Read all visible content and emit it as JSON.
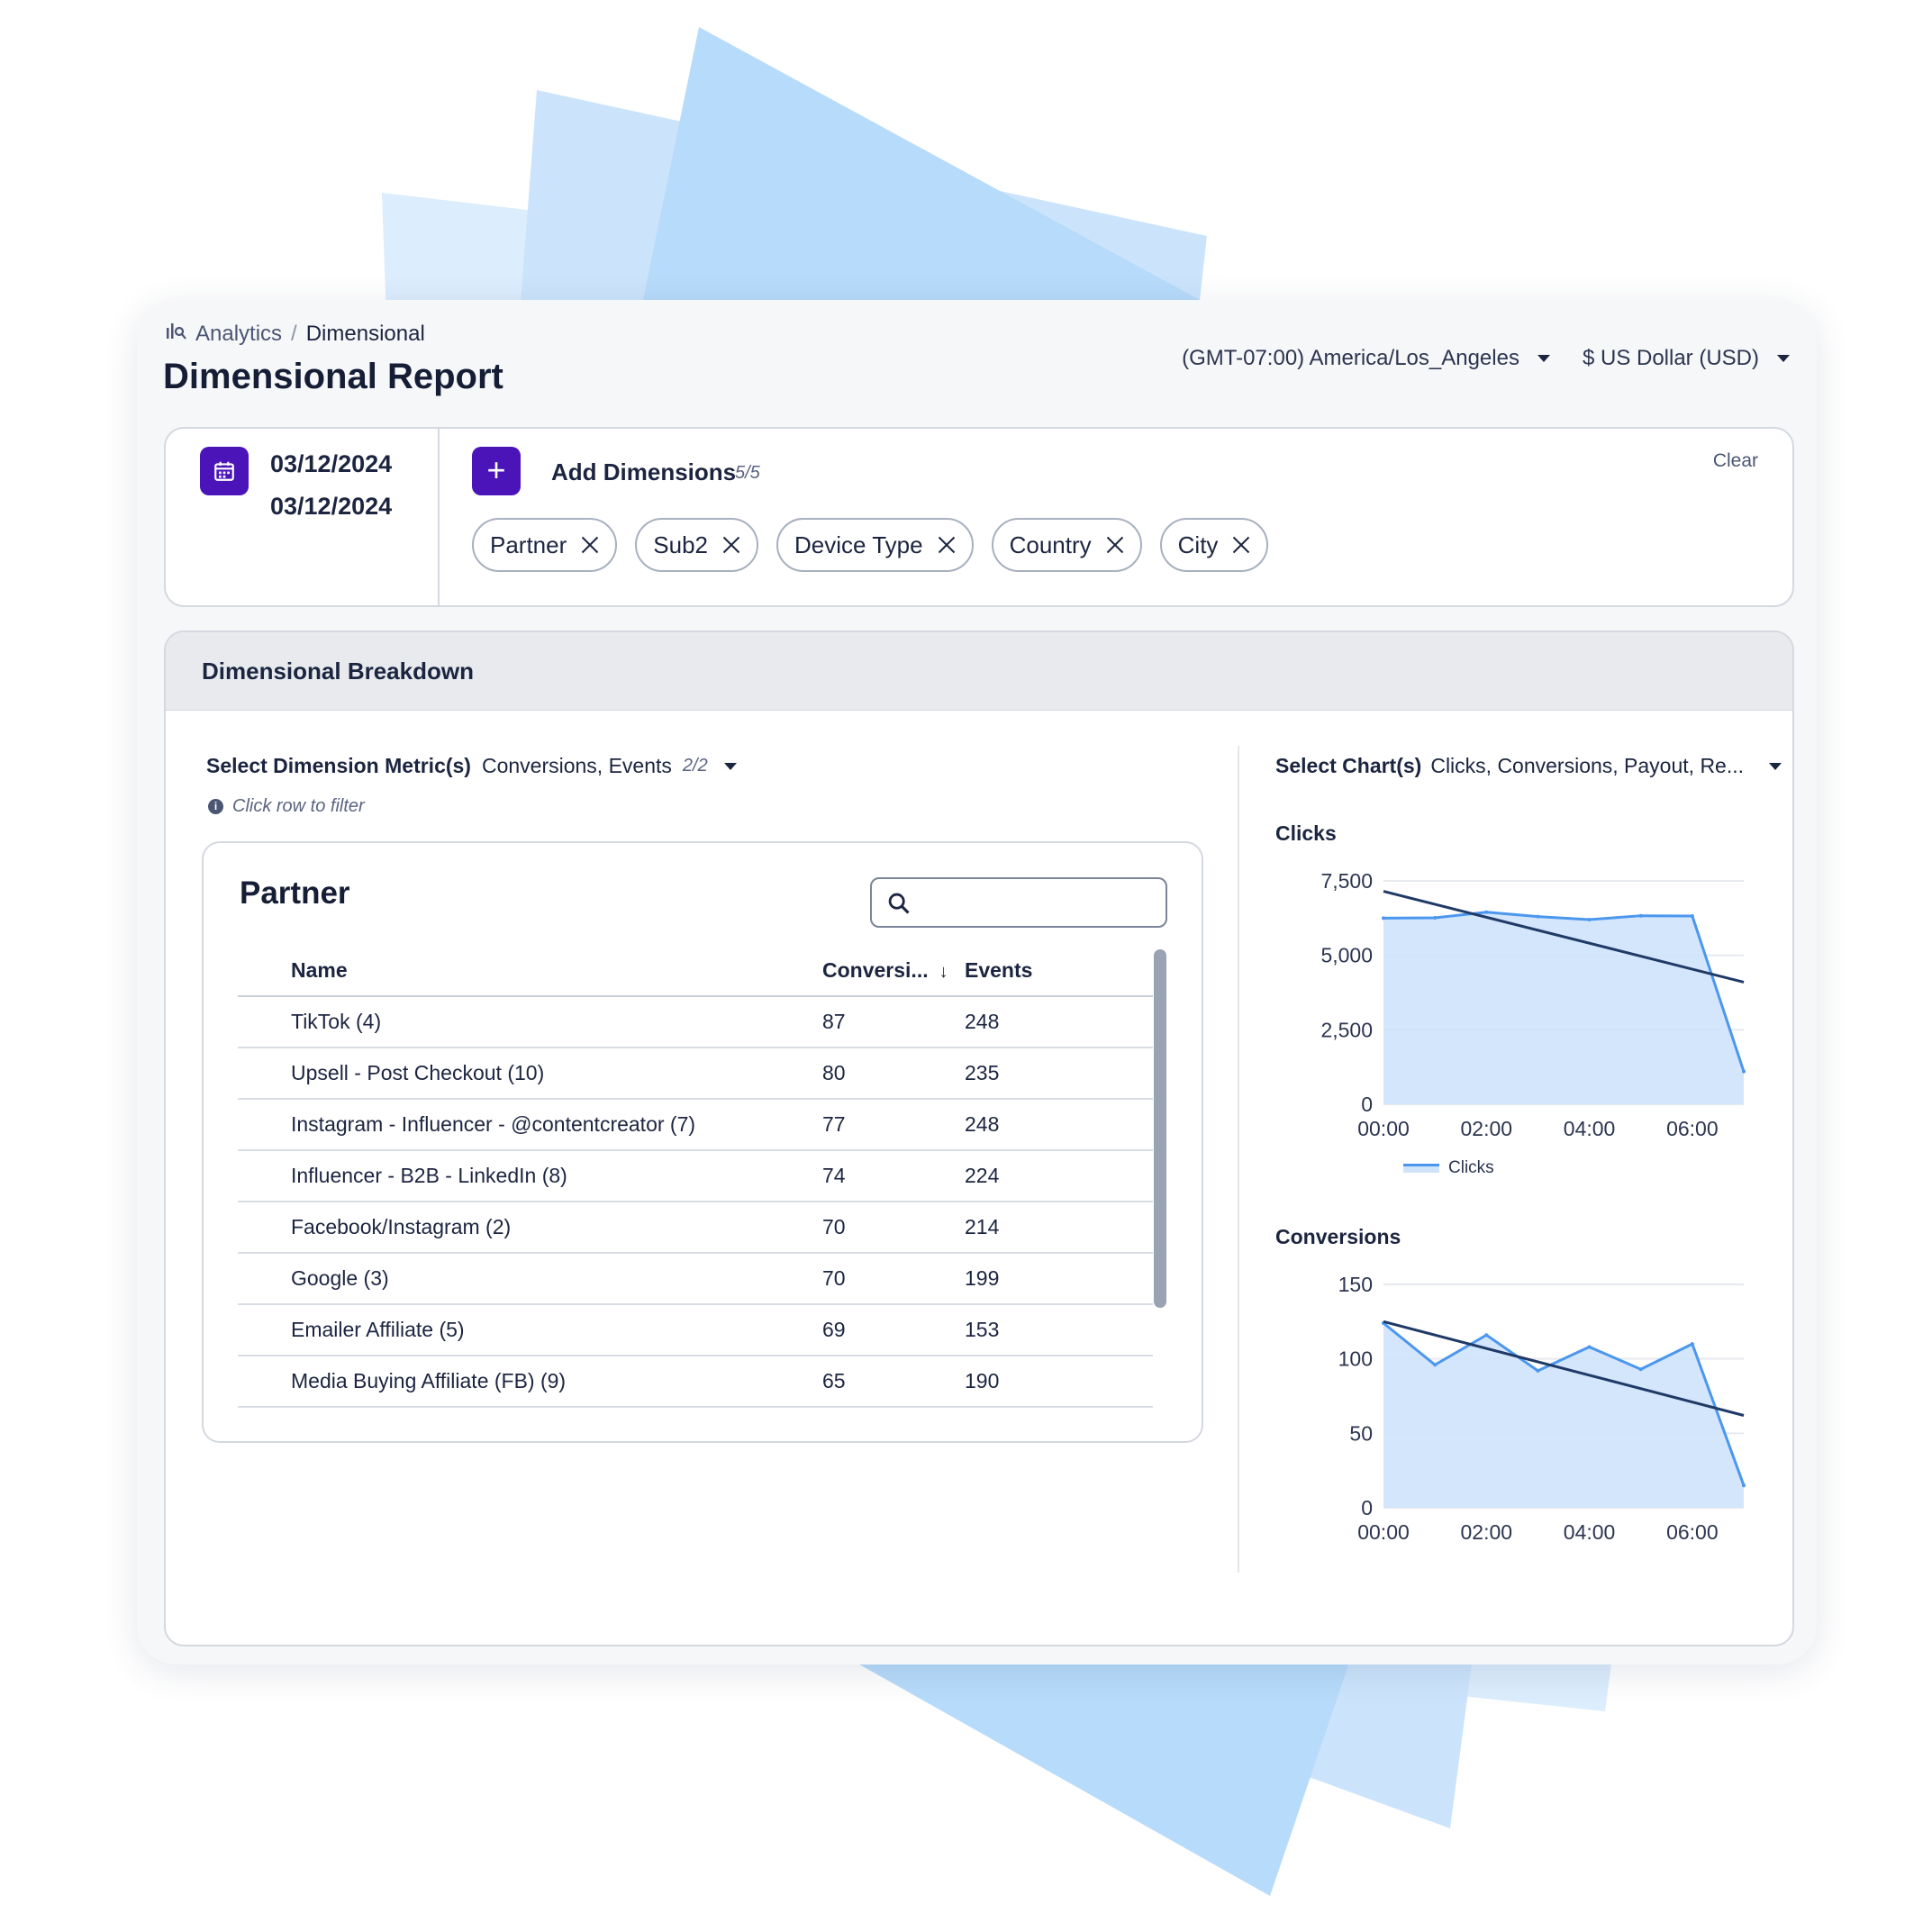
{
  "breadcrumb": {
    "parent": "Analytics",
    "separator": "/",
    "current": "Dimensional"
  },
  "page_title": "Dimensional Report",
  "timezone": "(GMT-07:00) America/Los_Angeles",
  "currency": "$ US Dollar (USD)",
  "date_range": {
    "start": "03/12/2024",
    "end": "03/12/2024"
  },
  "dimensions": {
    "add_label": "Add Dimensions",
    "count": "5/5",
    "clear_label": "Clear",
    "chips": [
      "Partner",
      "Sub2",
      "Device Type",
      "Country",
      "City"
    ]
  },
  "breakdown": {
    "title": "Dimensional Breakdown",
    "metric_label": "Select Dimension Metric(s)",
    "metric_value": "Conversions, Events",
    "metric_count": "2/2",
    "hint": "Click row to filter",
    "charts_label": "Select Chart(s)",
    "charts_value": "Clicks, Conversions, Payout, Re..."
  },
  "table": {
    "title": "Partner",
    "search_placeholder": "",
    "columns": [
      "Name",
      "Conversi...",
      "Events"
    ],
    "rows": [
      [
        "TikTok (4)",
        "87",
        "248"
      ],
      [
        "Upsell - Post Checkout (10)",
        "80",
        "235"
      ],
      [
        "Instagram - Influencer - @contentcreator (7)",
        "77",
        "248"
      ],
      [
        "Influencer - B2B - LinkedIn (8)",
        "74",
        "224"
      ],
      [
        "Facebook/Instagram (2)",
        "70",
        "214"
      ],
      [
        "Google (3)",
        "70",
        "199"
      ],
      [
        "Emailer Affiliate (5)",
        "69",
        "153"
      ],
      [
        "Media Buying Affiliate (FB) (9)",
        "65",
        "190"
      ]
    ]
  },
  "colors": {
    "accent": "#4b14b8",
    "area_fill": "#cfe3fb",
    "area_line": "#4c97ee",
    "trend_line": "#1f3a66"
  },
  "chart_data": [
    {
      "type": "area",
      "title": "Clicks",
      "x": [
        "00:00",
        "01:00",
        "02:00",
        "03:00",
        "04:00",
        "05:00",
        "06:00",
        "07:00"
      ],
      "x_ticks": [
        "00:00",
        "02:00",
        "04:00",
        "06:00"
      ],
      "series": [
        {
          "name": "Clicks",
          "values": [
            6250,
            6260,
            6450,
            6300,
            6200,
            6330,
            6320,
            1100
          ]
        }
      ],
      "trendline": [
        7150,
        4100
      ],
      "ylim": [
        0,
        7500
      ],
      "y_ticks": [
        "0",
        "2,500",
        "5,000",
        "7,500"
      ],
      "legend": "bottom"
    },
    {
      "type": "area",
      "title": "Conversions",
      "x": [
        "00:00",
        "01:00",
        "02:00",
        "03:00",
        "04:00",
        "05:00",
        "06:00",
        "07:00"
      ],
      "x_ticks": [
        "00:00",
        "02:00",
        "04:00",
        "06:00"
      ],
      "series": [
        {
          "values": [
            124,
            96,
            116,
            92,
            108,
            93,
            110,
            15
          ]
        }
      ],
      "trendline": [
        125,
        62
      ],
      "ylim": [
        0,
        150
      ],
      "y_ticks": [
        "0",
        "50",
        "100",
        "150"
      ]
    }
  ]
}
